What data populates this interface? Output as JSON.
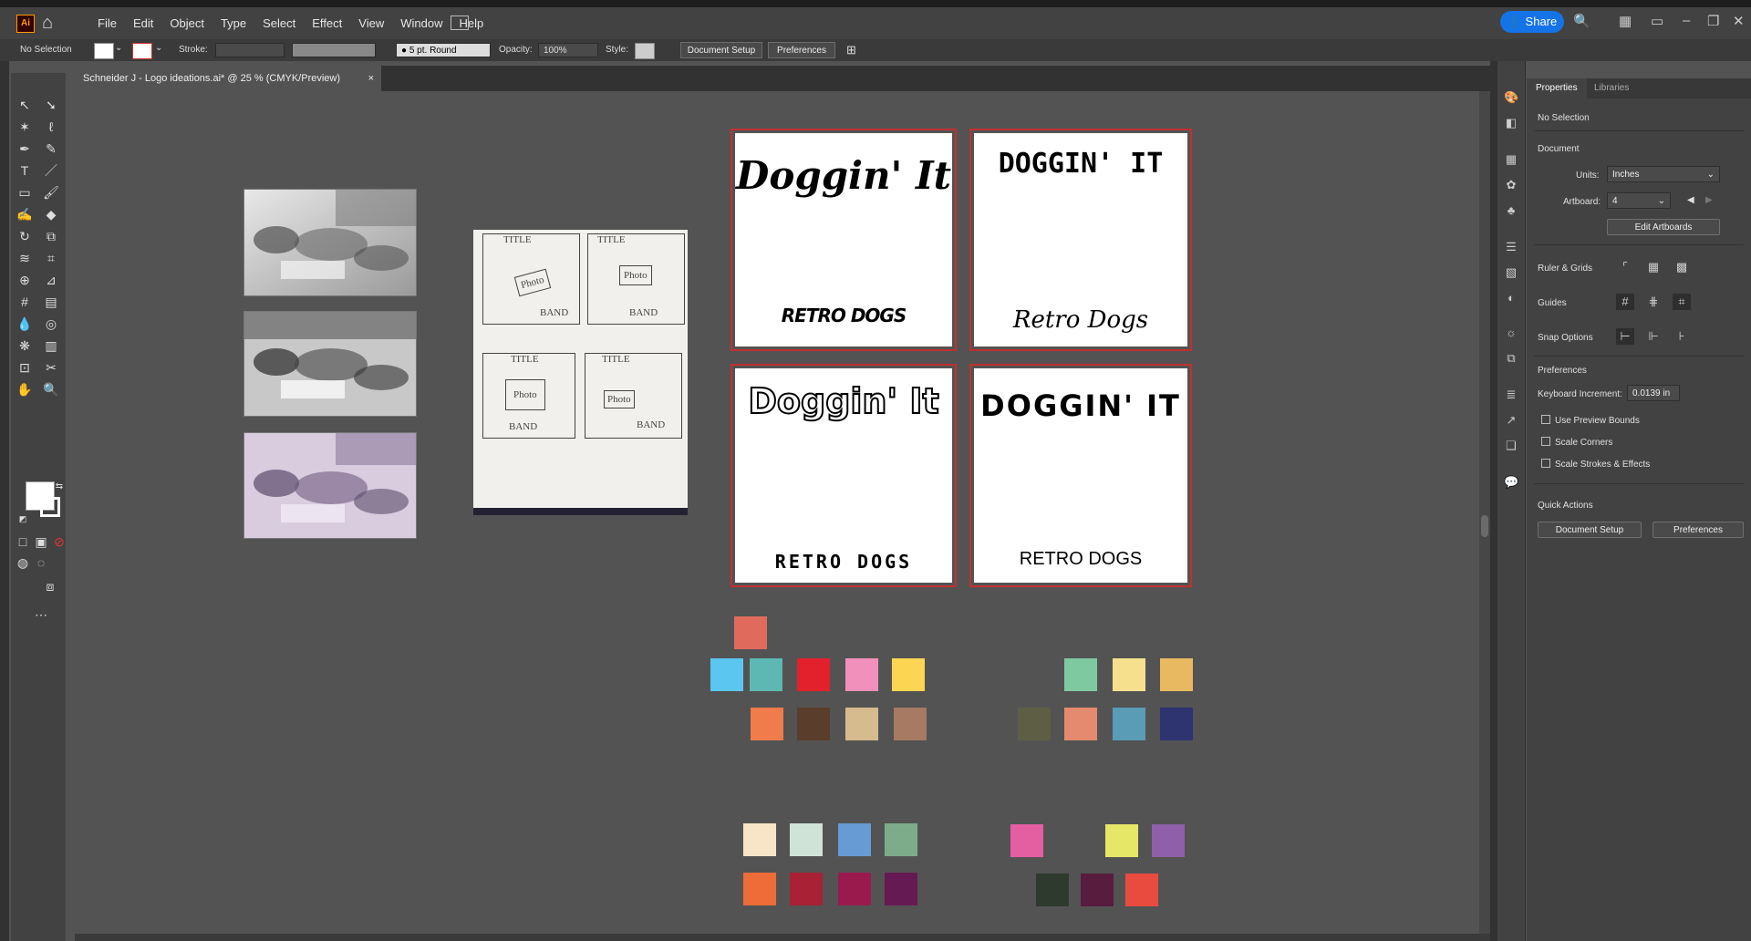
{
  "app": {
    "logo_text": "Ai"
  },
  "menu": [
    "File",
    "Edit",
    "Object",
    "Type",
    "Select",
    "Effect",
    "View",
    "Window",
    "Help"
  ],
  "share_label": "Share",
  "control_bar": {
    "selection": "No Selection",
    "stroke_label": "Stroke:",
    "brush_label": "5 pt. Round",
    "opacity_label": "Opacity:",
    "opacity_value": "100%",
    "style_label": "Style:",
    "document_setup": "Document Setup",
    "preferences": "Preferences"
  },
  "document_tab": {
    "title": "Schneider J - Logo ideations.ai* @ 25 % (CMYK/Preview)",
    "close": "×"
  },
  "sketch": {
    "cells": [
      {
        "title": "TITLE",
        "photo": "Photo",
        "band": "BAND"
      },
      {
        "title": "TITLE",
        "photo": "Photo",
        "band": "BAND"
      },
      {
        "title": "TITLE",
        "photo": "Photo",
        "band": "BAND"
      },
      {
        "title": "TITLE",
        "photo": "Photo",
        "band": "BAND"
      }
    ]
  },
  "artboards": [
    {
      "title": "Doggin' It",
      "subtitle": "RETRO DOGS"
    },
    {
      "title": "DOGGIN' IT",
      "subtitle": "Retro Dogs"
    },
    {
      "title": "Doggin' It",
      "subtitle": "RETRO DOGS"
    },
    {
      "title": "DOGGIN' IT",
      "subtitle": "RETRO DOGS"
    }
  ],
  "swatches": {
    "group_left_top": [
      "#e06b5c"
    ],
    "group_left_row2": [
      "#5bc6f0",
      "#5db8b4",
      "#e3212d",
      "#f190ba",
      "#fcd553"
    ],
    "group_left_row3": [
      "#ef7c4a",
      "#5b3d2b",
      "#d6bb8e",
      "#a67a63"
    ],
    "group_right_row2": [
      "#7fc9a1",
      "#f6e08e",
      "#e9b962"
    ],
    "group_right_row3": [
      "#5d5e44",
      "#e58a6e",
      "#5a9bb6",
      "#2d3470"
    ],
    "group_bottom_left_row1": [
      "#f8e5c7",
      "#cfe3d6",
      "#669bd3",
      "#7dac8b"
    ],
    "group_bottom_left_row2": [
      "#ed6c38",
      "#a82134",
      "#9a1a4e",
      "#661a53"
    ],
    "group_bottom_right_row1": [
      "#e45ea2",
      "#e6e766",
      "#8f5fa9"
    ],
    "group_bottom_right_row2": [
      "#2f3a2f",
      "#581c3e",
      "#ea4b3f"
    ]
  },
  "properties_panel": {
    "tab_properties": "Properties",
    "tab_libraries": "Libraries",
    "selection": "No Selection",
    "document_heading": "Document",
    "units_label": "Units:",
    "units_value": "Inches",
    "artboard_label": "Artboard:",
    "artboard_value": "4",
    "edit_artboards": "Edit Artboards",
    "ruler_grids": "Ruler & Grids",
    "guides": "Guides",
    "snap_options": "Snap Options",
    "preferences_heading": "Preferences",
    "keyboard_increment_label": "Keyboard Increment:",
    "keyboard_increment_value": "0.0139 in",
    "use_preview_bounds": "Use Preview Bounds",
    "scale_corners": "Scale Corners",
    "scale_strokes": "Scale Strokes & Effects",
    "quick_actions": "Quick Actions",
    "qa_document_setup": "Document Setup",
    "qa_preferences": "Preferences"
  }
}
